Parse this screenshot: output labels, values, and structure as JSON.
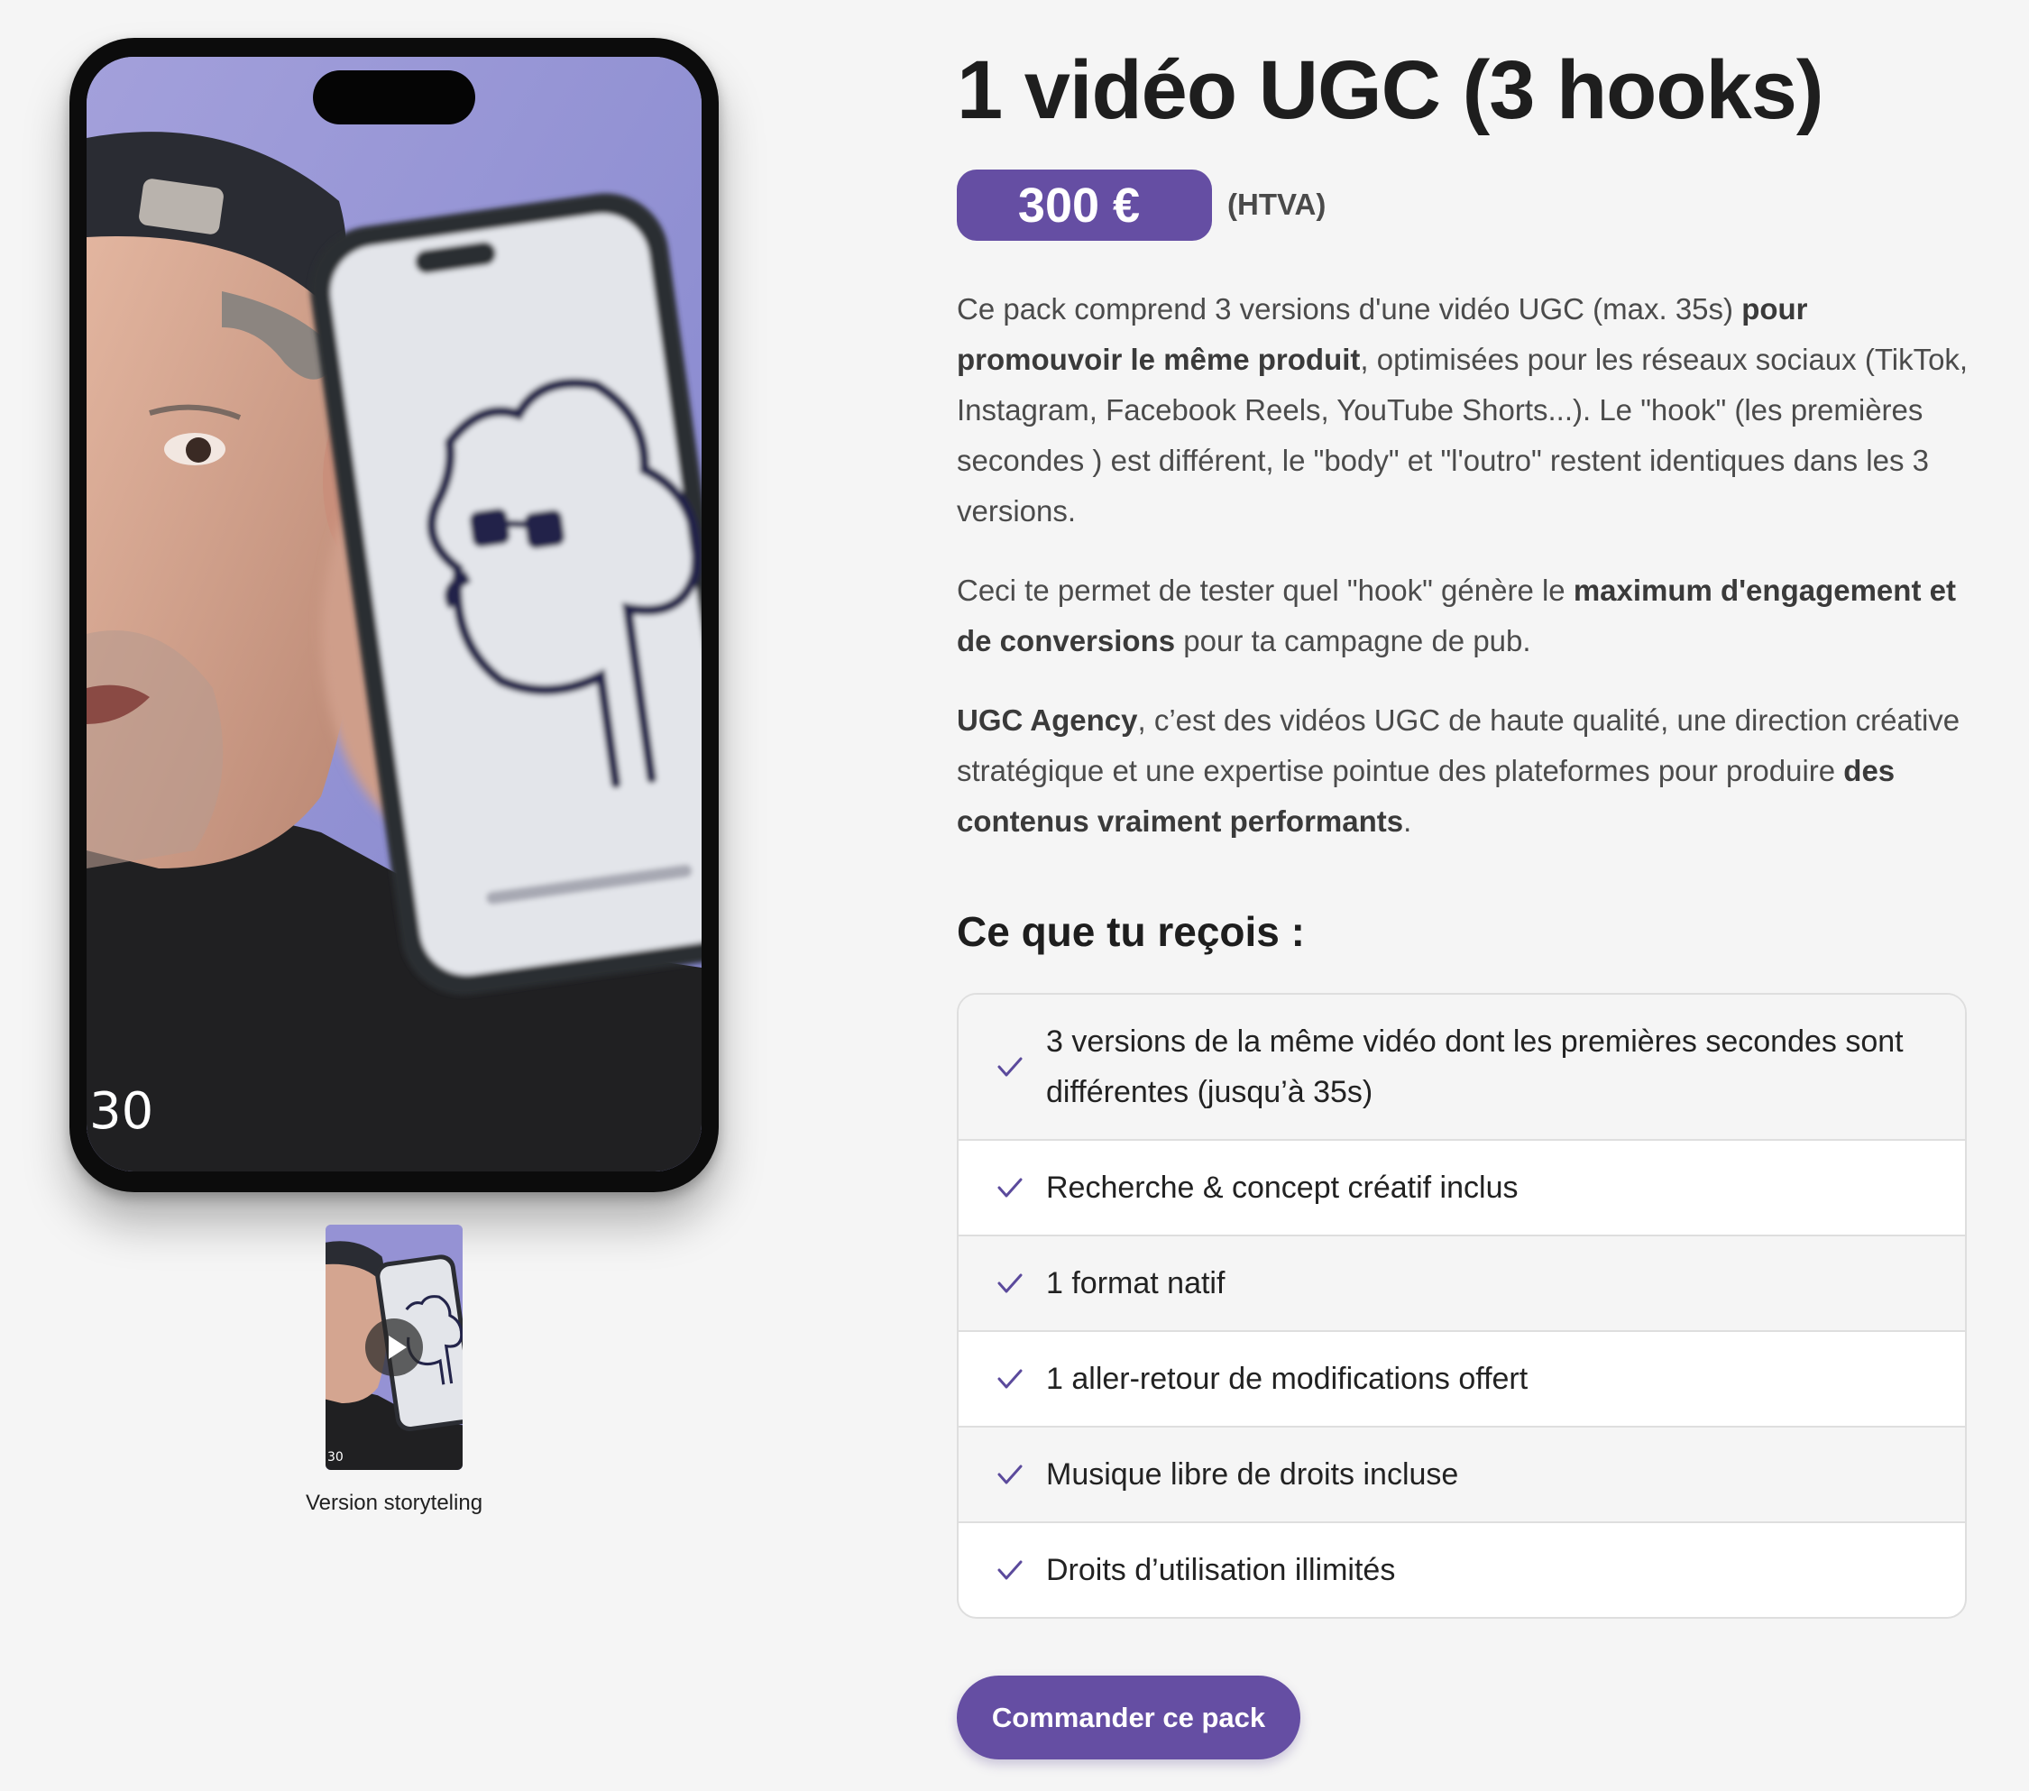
{
  "product": {
    "title": "1 vidéo UGC (3 hooks)",
    "price": "300 €",
    "price_note": "(HTVA)"
  },
  "description": {
    "p1": [
      {
        "text": "Ce pack comprend 3 versions d'une vidéo UGC (max. 35s) ",
        "bold": false
      },
      {
        "text": "pour promouvoir le même produit",
        "bold": true
      },
      {
        "text": ", optimisées pour les réseaux sociaux (TikTok, Instagram, Facebook Reels, YouTube Shorts...). Le \"hook\" (les premières secondes ) est différent, le \"body\" et \"l'outro\" restent identiques dans les 3 versions.",
        "bold": false
      }
    ],
    "p2": [
      {
        "text": "Ceci te permet de tester quel \"hook\" génère le ",
        "bold": false
      },
      {
        "text": "maximum d'engagement et de conversions",
        "bold": true
      },
      {
        "text": " pour ta campagne de pub.",
        "bold": false
      }
    ],
    "p3": [
      {
        "text": "UGC Agency",
        "bold": true
      },
      {
        "text": ", c’est des vidéos UGC de haute qualité, une direction créative stratégique et une expertise pointue des plateformes pour produire ",
        "bold": false
      },
      {
        "text": "des contenus vraiment performants",
        "bold": true
      },
      {
        "text": ".",
        "bold": false
      }
    ]
  },
  "features": {
    "title": "Ce que tu reçois :",
    "items": [
      "3 versions de la même vidéo dont les premières secondes sont différentes (jusqu’à 35s)",
      "Recherche & concept créatif inclus",
      "1 format natif",
      "1 aller-retour de modifications offert",
      "Musique libre de droits incluse",
      "Droits d’utilisation illimités"
    ]
  },
  "cta": {
    "label": "Commander ce pack"
  },
  "video": {
    "counter": "30",
    "thumb_counter": "30",
    "thumb_caption": "Version storyteling"
  },
  "colors": {
    "accent": "#654ea3",
    "check": "#5b4a9c",
    "background": "#f5f5f5"
  }
}
